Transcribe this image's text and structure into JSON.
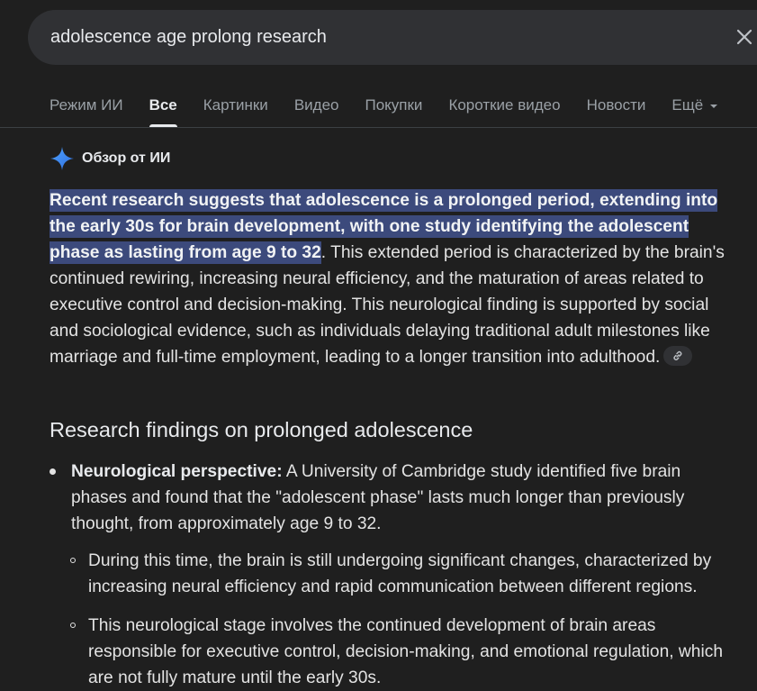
{
  "search": {
    "query": "adolescence age prolong research"
  },
  "tabs": [
    {
      "label": "Режим ИИ"
    },
    {
      "label": "Все"
    },
    {
      "label": "Картинки"
    },
    {
      "label": "Видео"
    },
    {
      "label": "Покупки"
    },
    {
      "label": "Короткие видео"
    },
    {
      "label": "Новости"
    },
    {
      "label": "Ещё"
    }
  ],
  "ai_overview": {
    "title": "Обзор от ИИ",
    "highlighted": "Recent research suggests that adolescence is a prolonged period, extending into the early 30s for brain development, with one study identifying the adolescent phase as lasting from age 9 to 32",
    "rest": ". This extended period is characterized by the brain's continued rewiring, increasing neural efficiency, and the maturation of areas related to executive control and decision-making. This neurological finding is supported by social and sociological evidence, such as individuals delaying traditional adult milestones like marriage and full-time employment, leading to a longer transition into adulthood."
  },
  "section": {
    "heading": "Research findings on prolonged adolescence",
    "bullets": [
      {
        "label": "Neurological perspective:",
        "text": " A University of Cambridge study identified five brain phases and found that the \"adolescent phase\" lasts much longer than previously thought, from approximately age 9 to 32."
      }
    ],
    "sub_bullets": [
      {
        "text": "During this time, the brain is still undergoing significant changes, characterized by increasing neural efficiency and rapid communication between different regions."
      },
      {
        "text": "This neurological stage involves the continued development of brain areas responsible for executive control, decision-making, and emotional regulation, which are not fully mature until the early 30s."
      }
    ]
  },
  "icons": {
    "clear": "close-icon",
    "sparkle": "ai-sparkle-icon",
    "link": "link-icon",
    "more": "chevron-down-icon"
  },
  "colors": {
    "background": "#1f1f1f",
    "search_bg": "#303134",
    "highlight": "#3c4a7c",
    "sparkle": "#4285f4"
  }
}
